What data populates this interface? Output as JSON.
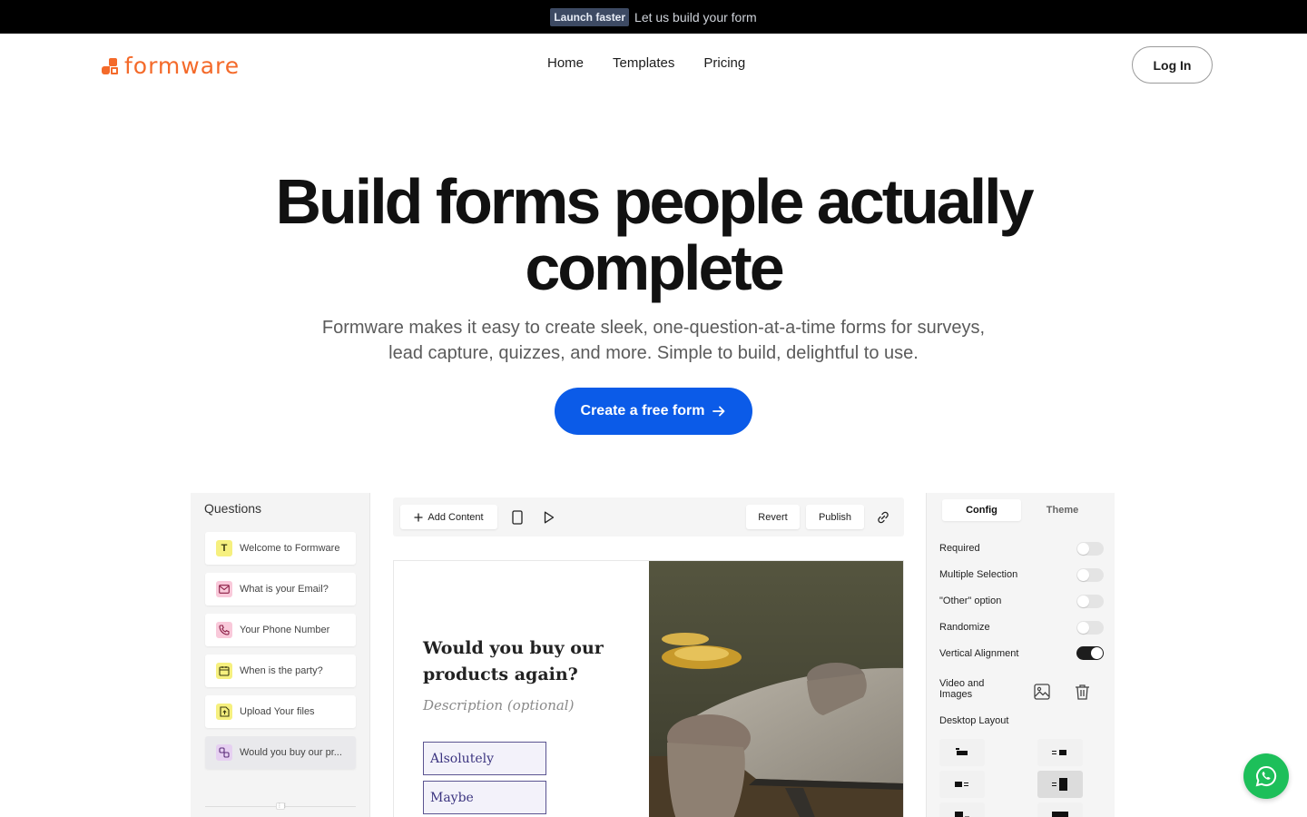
{
  "announcement": {
    "badge": "Launch faster",
    "message": "Let us build your form"
  },
  "brand": {
    "name": "formware",
    "color": "#f46a2a"
  },
  "nav": {
    "items": [
      "Home",
      "Templates",
      "Pricing"
    ],
    "login": "Log In"
  },
  "hero": {
    "title_line1": "Build forms people actually",
    "title_line2": "complete",
    "subtitle_line1": "Formware makes it easy to create sleek, one-question-at-a-time forms for surveys,",
    "subtitle_line2": "lead capture, quizzes, and more. Simple to build, delightful to use.",
    "cta": "Create a free form",
    "cta_color": "#0b5be8"
  },
  "questions_panel": {
    "title": "Questions",
    "items": [
      {
        "label": "Welcome to Formware",
        "icon": "text-icon",
        "glyph": "T"
      },
      {
        "label": "What is your Email?",
        "icon": "mail-icon"
      },
      {
        "label": "Your Phone Number",
        "icon": "phone-icon"
      },
      {
        "label": "When is the party?",
        "icon": "calendar-icon"
      },
      {
        "label": "Upload Your files",
        "icon": "upload-icon"
      },
      {
        "label": "Would you buy our pr...",
        "icon": "choice-icon",
        "active": true
      }
    ]
  },
  "editor_toolbar": {
    "add_content": "Add Content",
    "revert": "Revert",
    "publish": "Publish",
    "icons": [
      "mobile-preview-icon",
      "play-icon",
      "link-icon"
    ]
  },
  "preview": {
    "question": "Would you buy our products again?",
    "question_line1": "Would you buy our",
    "question_line2": "products again?",
    "description": "Description (optional)",
    "options": [
      "Alsolutely",
      "Maybe"
    ]
  },
  "config_panel": {
    "tabs": [
      "Config",
      "Theme"
    ],
    "active_tab": "Config",
    "settings": [
      {
        "label": "Required",
        "on": false
      },
      {
        "label": "Multiple Selection",
        "on": false
      },
      {
        "label": "\"Other\" option",
        "on": false
      },
      {
        "label": "Randomize",
        "on": false
      },
      {
        "label": "Vertical Alignment",
        "on": true
      }
    ],
    "media_label_line1": "Video and",
    "media_label_line2": "Images",
    "layout_label": "Desktop Layout"
  },
  "chat_color": "#1dbf5a"
}
